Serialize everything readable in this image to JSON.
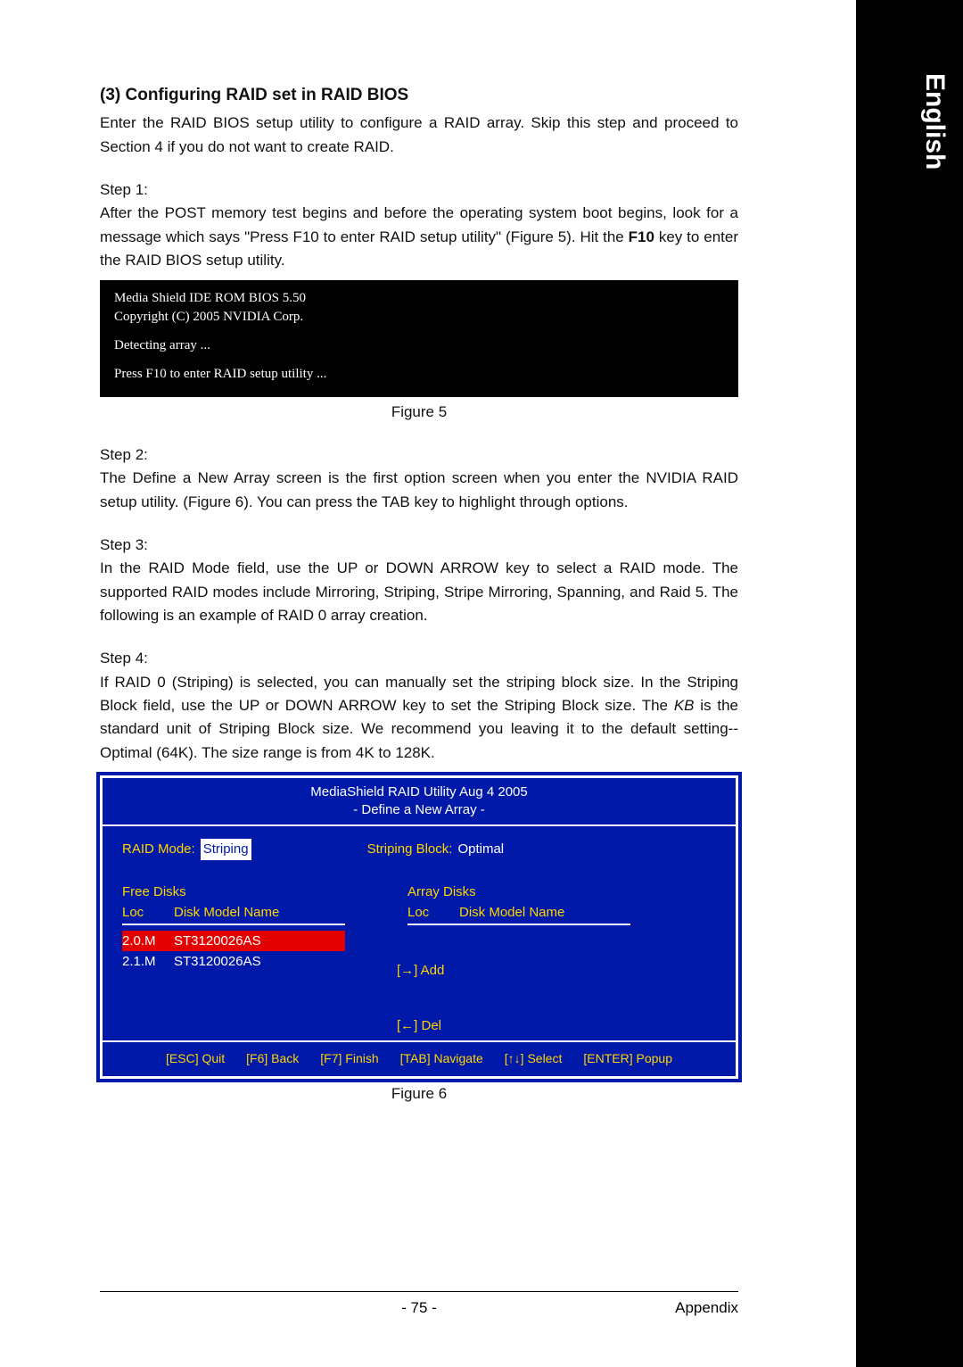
{
  "lang": "English",
  "heading": "(3) Configuring RAID set in RAID BIOS",
  "intro": "Enter the RAID BIOS setup utility to configure a RAID array. Skip this step and proceed to Section 4 if you do not want to create RAID.",
  "step1_label": "Step 1:",
  "step1_text_a": "After the POST memory test begins and before the operating system boot begins, look for a message which says \"Press F10 to enter RAID setup utility\" (Figure 5). Hit the ",
  "step1_bold": "F10",
  "step1_text_b": " key to enter the RAID BIOS setup utility.",
  "bios": {
    "l1": "Media Shield IDE ROM BIOS 5.50",
    "l2": "Copyright (C) 2005 NVIDIA Corp.",
    "l3": "Detecting array ...",
    "l4": "Press F10 to enter RAID setup utility ..."
  },
  "fig5": "Figure 5",
  "step2_label": "Step 2:",
  "step2_text": "The Define a New Array screen is the first option screen when you enter the NVIDIA RAID setup utility. (Figure 6). You can press the TAB key to highlight through options.",
  "step3_label": "Step 3:",
  "step3_text": "In the RAID Mode field, use the UP or DOWN ARROW key to select a RAID mode. The supported RAID modes include Mirroring, Striping, Stripe Mirroring, Spanning, and Raid 5. The following is an example of RAID 0 array creation.",
  "step4_label": "Step 4:",
  "step4_text_a": "If RAID 0 (Striping) is selected, you can manually set the striping block size. In the Striping Block field, use the UP or DOWN ARROW key to set the Striping Block size. The ",
  "step4_ital": "KB",
  "step4_text_b": " is the standard unit of Striping Block size.  We recommend you leaving it to the default setting--Optimal (64K). The size range is from 4K to 128K.",
  "raid": {
    "title1": "MediaShield RAID Utility  Aug 4 2005",
    "title2": "- Define a New Array -",
    "mode_label": "RAID Mode:",
    "mode_value": "Striping",
    "block_label": "Striping Block:",
    "block_value": "Optimal",
    "free_title": "Free Disks",
    "array_title": "Array Disks",
    "col_loc": "Loc",
    "col_model": "Disk Model Name",
    "free": [
      {
        "loc": "2.0.M",
        "model": "ST3120026AS",
        "selected": true
      },
      {
        "loc": "2.1.M",
        "model": "ST3120026AS",
        "selected": false
      }
    ],
    "arrow_add": "[→] Add",
    "arrow_del": "[←] Del",
    "footer": {
      "esc": "[ESC] Quit",
      "f6": "[F6] Back",
      "f7": "[F7] Finish",
      "tab": "[TAB] Navigate",
      "sel": "[↑↓] Select",
      "enter": "[ENTER] Popup"
    }
  },
  "fig6": "Figure 6",
  "page_num": "- 75 -",
  "appendix": "Appendix"
}
